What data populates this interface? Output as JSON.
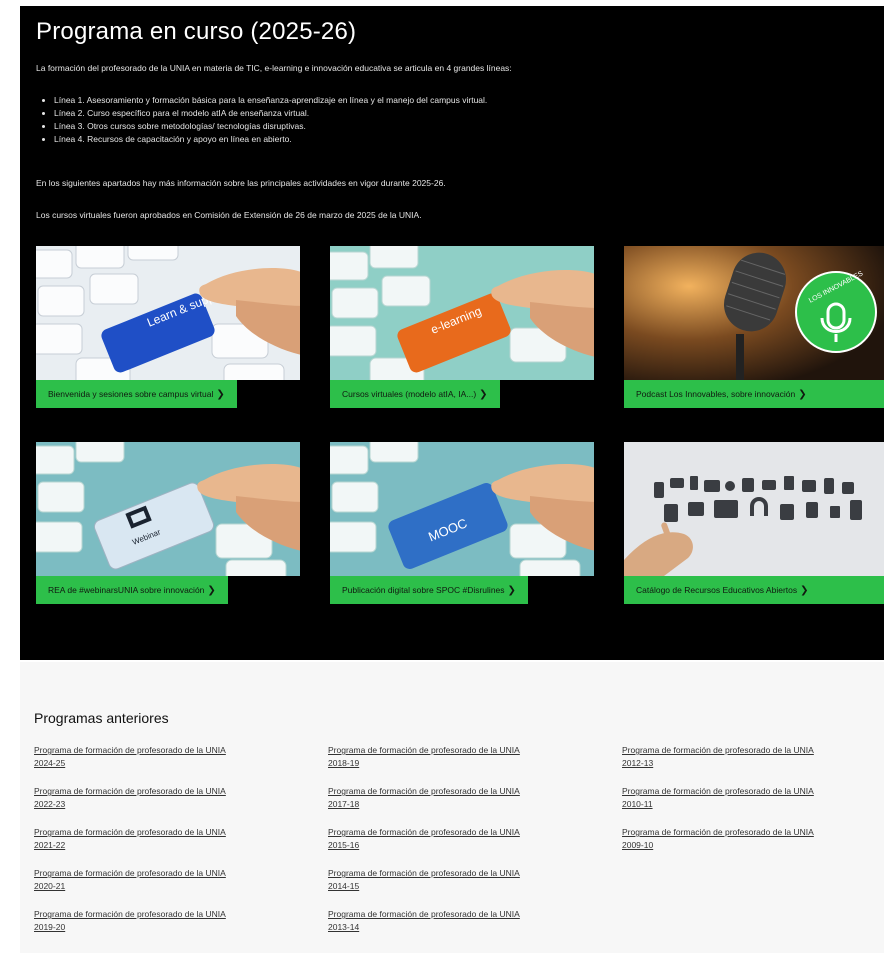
{
  "hero": {
    "title": "Programa en curso (2025-26)",
    "intro": "La formación del profesorado de la UNIA en materia de TIC, e-learning e innovación educativa se articula en 4 grandes líneas:",
    "lines": [
      "Línea 1. Asesoramiento y formación básica para la enseñanza-aprendizaje en línea y el manejo del campus virtual.",
      "Línea 2. Curso específico para el modelo atIA de enseñanza virtual.",
      "Línea 3. Otros cursos sobre metodologías/ tecnologías disruptivas.",
      "Línea 4. Recursos de capacitación y apoyo en línea en abierto."
    ],
    "paragraph2": "En los siguientes apartados hay más información sobre las principales actividades en vigor durante 2025-26.",
    "paragraph3": "Los cursos virtuales fueron aprobados en Comisión de Extensión de 26 de marzo de 2025 de la UNIA."
  },
  "cards": [
    {
      "label": "Bienvenida y sesiones sobre campus virtual",
      "key_text": "Learn & support",
      "key_color": "#1f4fc6"
    },
    {
      "label": "Cursos virtuales (modelo atIA, IA...)",
      "key_text": "e-learning",
      "key_color": "#e86a1c"
    },
    {
      "label": "Podcast Los Innovables, sobre innovación",
      "badge_text": "LOS INNOVABLES",
      "badge_color": "#2dbf4a"
    },
    {
      "label": "REA de #webinarsUNIA sobre innovación",
      "key_text": "Webinar",
      "key_color": "#d9e7f2"
    },
    {
      "label": "Publicación digital sobre SPOC #Disrulines",
      "key_text": "MOOC",
      "key_color": "#2f6fc6"
    },
    {
      "label": "Catálogo de Recursos Educativos Abiertos"
    }
  ],
  "previous": {
    "title": "Programas anteriores",
    "link_prefix": "Programa de formación de profesorado de la UNIA",
    "columns": [
      [
        "2024-25",
        "2022-23",
        "2021-22",
        "2020-21",
        "2019-20"
      ],
      [
        "2018-19",
        "2017-18",
        "2015-16",
        "2014-15",
        "2013-14"
      ],
      [
        "2012-13",
        "2010-11",
        "2009-10"
      ]
    ]
  },
  "colors": {
    "hero_bg": "#000000",
    "accent_green": "#2dbf4a",
    "lower_bg": "#f7f7f7"
  },
  "icons": {
    "chevron": "chevron-right-icon",
    "microphone": "microphone-icon",
    "hand": "hand-icon"
  }
}
